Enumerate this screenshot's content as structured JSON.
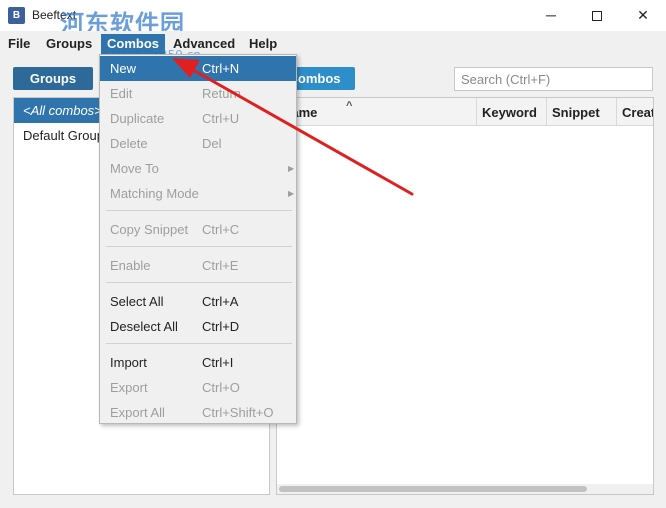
{
  "window": {
    "title": "Beeftext",
    "icon": "app-icon",
    "watermark": "河东软件园",
    "watermark_url": "www.pc0359.cn",
    "min_symbol": "─",
    "close_symbol": "✕"
  },
  "menubar": {
    "items": [
      "File",
      "Groups",
      "Combos",
      "Advanced",
      "Help"
    ],
    "active": "Combos"
  },
  "toolbar": {
    "groups_label": "Groups",
    "combos_label": "Combos",
    "search_placeholder": "Search (Ctrl+F)"
  },
  "groups": {
    "items": [
      "<All combos>",
      "Default Group"
    ],
    "selected": "<All combos>"
  },
  "combos_table": {
    "columns": [
      "Name",
      "Keyword",
      "Snippet",
      "Creat"
    ],
    "rows": []
  },
  "combos_menu": {
    "items": [
      {
        "label": "New",
        "shortcut": "Ctrl+N",
        "enabled": true,
        "highlighted": true
      },
      {
        "label": "Edit",
        "shortcut": "Return",
        "enabled": false
      },
      {
        "label": "Duplicate",
        "shortcut": "Ctrl+U",
        "enabled": false
      },
      {
        "label": "Delete",
        "shortcut": "Del",
        "enabled": false
      },
      {
        "label": "Move To",
        "shortcut": "",
        "enabled": false,
        "submenu": true
      },
      {
        "label": "Matching Mode",
        "shortcut": "",
        "enabled": false,
        "submenu": true
      },
      {
        "label": "Copy Snippet",
        "shortcut": "Ctrl+C",
        "enabled": false
      },
      {
        "label": "Enable",
        "shortcut": "Ctrl+E",
        "enabled": false
      },
      {
        "label": "Select All",
        "shortcut": "Ctrl+A",
        "enabled": true
      },
      {
        "label": "Deselect All",
        "shortcut": "Ctrl+D",
        "enabled": true
      },
      {
        "label": "Import",
        "shortcut": "Ctrl+I",
        "enabled": true
      },
      {
        "label": "Export",
        "shortcut": "Ctrl+O",
        "enabled": false
      },
      {
        "label": "Export All",
        "shortcut": "Ctrl+Shift+O",
        "enabled": false
      }
    ],
    "submenu_icon": "chevron-right-icon"
  },
  "colors": {
    "accent": "#2f74ac",
    "groups_button": "#2d6a99",
    "combos_button": "#2d8ec9",
    "annotation_arrow": "#e02020"
  }
}
